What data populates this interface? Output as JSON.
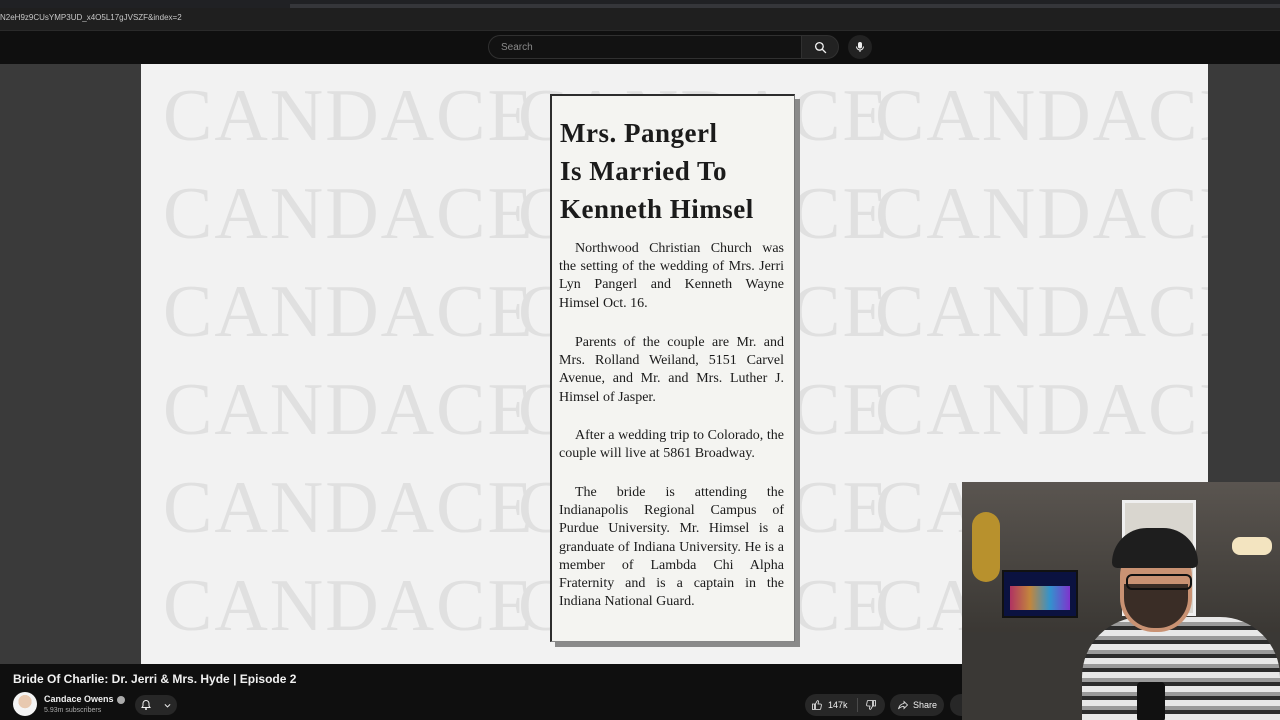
{
  "browser": {
    "url": "N2eH9z9CUsYMP3UD_x4O5L17gJVSZF&index=2"
  },
  "header": {
    "search_placeholder": "Search"
  },
  "slide": {
    "watermark": "CANDACE",
    "clipping": {
      "headline": [
        "Mrs. Pangerl",
        "Is Married To",
        "Kenneth Himsel"
      ],
      "paragraphs": [
        "Northwood Christian Church was the setting of the wedding of Mrs. Jerri Lyn Pangerl and Kenneth Wayne Himsel Oct. 16.",
        "Parents of the couple are Mr. and Mrs. Rolland Weiland, 5151 Carvel Avenue, and Mr. and Mrs. Luther J. Himsel of Jasper.",
        "After a wedding trip to Colorado, the couple will live at 5861 Broadway.",
        "The bride is attending the Indianapolis Regional Campus of Purdue University. Mr. Himsel is a granduate of Indiana University. He is a member of Lambda Chi Alpha Fraternity and is a captain in the Indiana National Guard."
      ]
    }
  },
  "video": {
    "title": "Bride Of Charlie: Dr. Jerri & Mrs. Hyde | Episode 2",
    "channel": "Candace Owens",
    "subscribers": "5.93m subscribers",
    "likes": "147k",
    "share_label": "Share"
  }
}
